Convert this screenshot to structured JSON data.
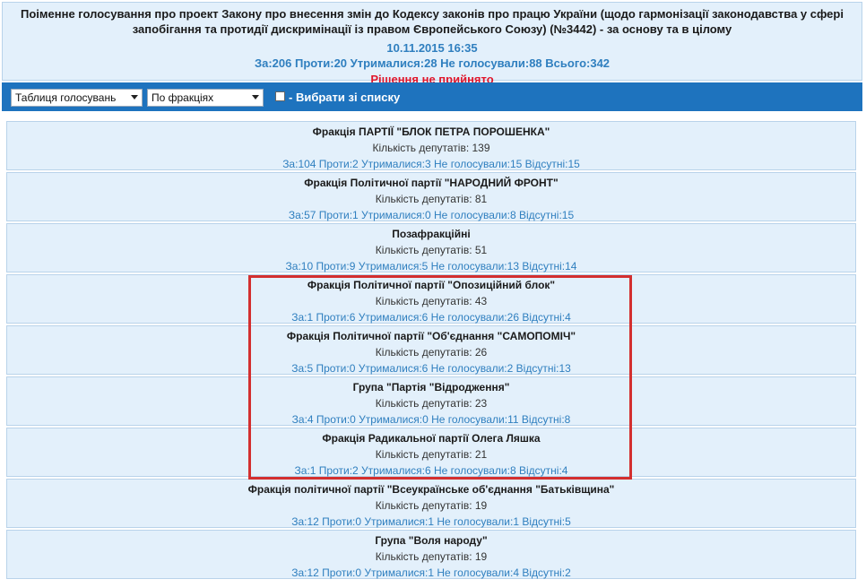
{
  "header": {
    "title": "Поіменне голосування про проект Закону про внесення змін до Кодексу законів про працю України (щодо гармонізації законодавства у сфері запобігання та протидії дискримінації із правом Європейського Союзу) (№3442) - за основу та в цілому",
    "datetime": "10.11.2015 16:35",
    "totals": "За:206 Проти:20 Утрималися:28 Не голосували:88 Всього:342",
    "decision": "Рішення не прийнято"
  },
  "toolbar": {
    "view_select": "Таблиця голосувань",
    "group_select": "По фракціях",
    "choose_label": "- Вибрати зі списку",
    "bg_color": "#1e73be"
  },
  "factions": [
    {
      "name": "Фракція ПАРТІЇ \"БЛОК ПЕТРА ПОРОШЕНКА\"",
      "count": "Кількість депутатів: 139",
      "votes": "За:104 Проти:2 Утрималися:3 Не голосували:15 Відсутні:15"
    },
    {
      "name": "Фракція Політичної партії \"НАРОДНИЙ ФРОНТ\"",
      "count": "Кількість депутатів: 81",
      "votes": "За:57 Проти:1 Утрималися:0 Не голосували:8 Відсутні:15"
    },
    {
      "name": "Позафракційні",
      "count": "Кількість депутатів: 51",
      "votes": "За:10 Проти:9 Утрималися:5 Не голосували:13 Відсутні:14"
    },
    {
      "name": "Фракція Політичної партії \"Опозиційний блок\"",
      "count": "Кількість депутатів: 43",
      "votes": "За:1 Проти:6 Утрималися:6 Не голосували:26 Відсутні:4"
    },
    {
      "name": "Фракція Політичної партії \"Об'єднання \"САМОПОМІЧ\"",
      "count": "Кількість депутатів: 26",
      "votes": "За:5 Проти:0 Утрималися:6 Не голосували:2 Відсутні:13"
    },
    {
      "name": "Група \"Партія \"Відродження\"",
      "count": "Кількість депутатів: 23",
      "votes": "За:4 Проти:0 Утрималися:0 Не голосували:11 Відсутні:8"
    },
    {
      "name": "Фракція Радикальної партії Олега Ляшка",
      "count": "Кількість депутатів: 21",
      "votes": "За:1 Проти:2 Утрималися:6 Не голосували:8 Відсутні:4"
    },
    {
      "name": "Фракція політичної партії \"Всеукраїнське об'єднання \"Батьківщина\"",
      "count": "Кількість депутатів: 19",
      "votes": "За:12 Проти:0 Утрималися:1 Не голосували:1 Відсутні:5"
    },
    {
      "name": "Група \"Воля народу\"",
      "count": "Кількість депутатів: 19",
      "votes": "За:12 Проти:0 Утрималися:1 Не голосували:4 Відсутні:2"
    }
  ],
  "colors": {
    "highlight_border": "#d32f2f",
    "panel_bg": "#e3f0fb",
    "link_blue": "#2f7fbf",
    "decision_red": "#e0162b"
  }
}
